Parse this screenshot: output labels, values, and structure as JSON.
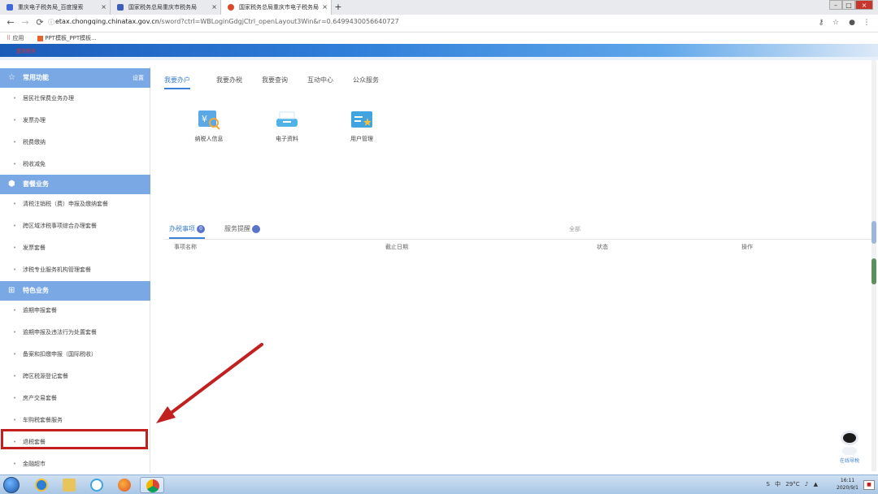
{
  "browser": {
    "tabs": [
      {
        "title": "重庆电子税务局_百度搜索",
        "active": false,
        "icon_color": "#3d6ad6"
      },
      {
        "title": "国家税务总局重庆市税务局",
        "active": false,
        "icon_color": "#3b5fb8"
      },
      {
        "title": "国家税务总局重庆市电子税务局",
        "active": true,
        "icon_color": "#d94a2a"
      }
    ],
    "tab_close_glyph": "×",
    "new_tab_glyph": "+",
    "window_controls": {
      "minimize": "–",
      "maximize": "□",
      "close": "×"
    },
    "url_host": "etax.chongqing.chinatax.gov.cn",
    "url_path": "/sword?ctrl=WBLoginGdgjCtrl_openLayout3Win&r=0.6499430056640727",
    "bookmarks": {
      "apps_label": "应用",
      "ppt_label": "PPT模板_PPT模板..."
    }
  },
  "site": {
    "logo_text": "重庆税务",
    "main_tabs": [
      "我要办户",
      "我要办税",
      "我要查询",
      "互动中心",
      "公众服务"
    ],
    "features": [
      {
        "label": "纳税人信息",
        "icon": "tax-info-icon"
      },
      {
        "label": "电子资料",
        "icon": "e-document-icon"
      },
      {
        "label": "用户管理",
        "icon": "user-manage-icon"
      }
    ],
    "low_tabs": [
      {
        "label": "办税事项",
        "badge": "0"
      },
      {
        "label": "服务提醒",
        "badge": ""
      }
    ],
    "low_tabs_more": "全部",
    "table_headers": [
      "事项名称",
      "截止日期",
      "状态",
      "操作"
    ]
  },
  "sidebar": {
    "sections": [
      {
        "title": "常用功能",
        "icon": "star-icon",
        "setting": "设置",
        "items": [
          "居民社保费业务办理",
          "发票办理",
          "税费缴纳",
          "税收减免"
        ]
      },
      {
        "title": "套餐业务",
        "icon": "package-icon",
        "setting": "",
        "items": [
          "清税注销税（费）申报及缴纳套餐",
          "跨区域涉税事项综合办理套餐",
          "发票套餐",
          "涉税专业服务机构管理套餐"
        ]
      },
      {
        "title": "特色业务",
        "icon": "grid-icon",
        "setting": "",
        "items": [
          "逾期申报套餐",
          "逾期申报及违法行为处置套餐",
          "备案和扣缴申报（国际税收）",
          "跨区税源登记套餐",
          "房产交易套餐",
          "车购税套餐服务",
          "退税套餐",
          "金融超市"
        ]
      }
    ],
    "highlighted_item": "退税套餐"
  },
  "help_robot": {
    "label": "在线导税"
  },
  "taskbar": {
    "apps": [
      "windows-explorer-icon",
      "ie-icon",
      "folder-icon",
      "baidu-netdisk-icon",
      "firefox-icon",
      "chrome-icon"
    ],
    "active_app": "chrome-icon",
    "tray_items": [
      "S",
      "中",
      "29°C",
      "♪",
      "▲"
    ],
    "time": "16:11",
    "date": "2020/9/1"
  },
  "colors": {
    "section_header": "#7aa8e4",
    "accent": "#3c7fd6",
    "annotation": "#c1201e"
  }
}
